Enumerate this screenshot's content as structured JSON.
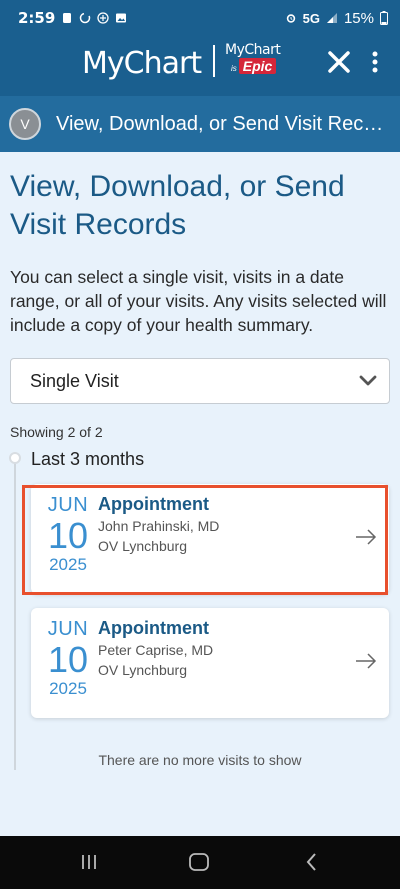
{
  "status_bar": {
    "time": "2:59",
    "network": "5G",
    "battery": "15%"
  },
  "header": {
    "brand": "MyChart",
    "partner_top": "MyChart",
    "partner_is": "is",
    "partner_bottom": "Epic",
    "close_icon": "close-icon",
    "more_icon": "more-vertical-icon"
  },
  "nav": {
    "avatar_initial": "V",
    "title": "View, Download, or Send Visit Records"
  },
  "main": {
    "title": "View, Download, or Send Visit Records",
    "intro": "You can select a single visit, visits in a date range, or all of your visits. Any visits selected will include a copy of your health summary.",
    "select": {
      "selected": "Single Visit",
      "icon": "chevron-down-icon"
    },
    "showing": "Showing 2 of 2",
    "period": "Last 3 months",
    "visits": [
      {
        "month": "JUN",
        "day": "10",
        "year": "2025",
        "type": "Appointment",
        "provider": "John Prahinski, MD",
        "location": "OV Lynchburg"
      },
      {
        "month": "JUN",
        "day": "10",
        "year": "2025",
        "type": "Appointment",
        "provider": "Peter Caprise, MD",
        "location": "OV Lynchburg"
      }
    ],
    "no_more": "There are no more visits to show"
  },
  "colors": {
    "header": "#1a5f8f",
    "nav": "#236c9e",
    "accent": "#3a8fd0",
    "title": "#1b5a86",
    "highlight": "#e8502d",
    "background": "#e8f2fb"
  }
}
